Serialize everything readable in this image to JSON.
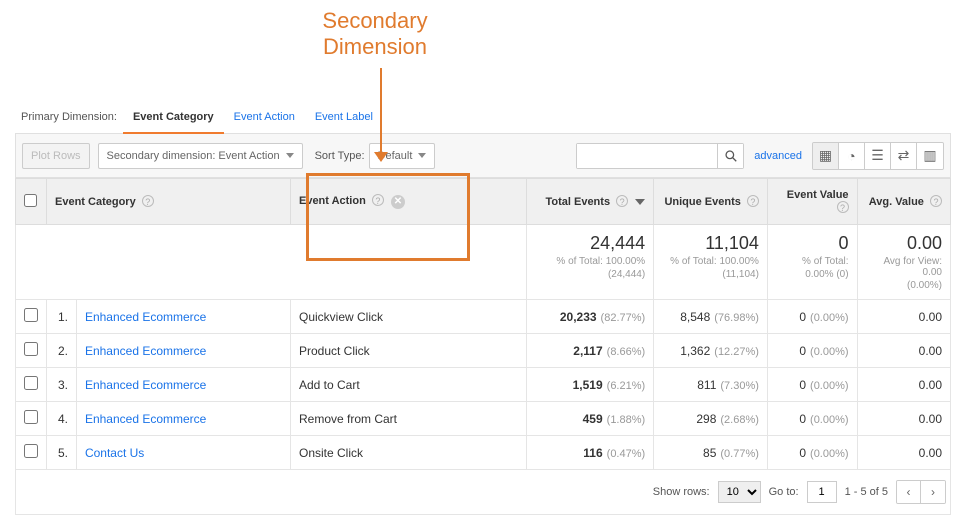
{
  "annotation": "Secondary Dimension",
  "primary": {
    "label": "Primary Dimension:",
    "options": [
      "Event Category",
      "Event Action",
      "Event Label"
    ],
    "active": "Event Category"
  },
  "toolbar": {
    "plot_rows": "Plot Rows",
    "secondary_dimension": "Secondary dimension: Event Action",
    "sort_type_label": "Sort Type:",
    "sort_type_value": "Default",
    "search_value": "",
    "advanced": "advanced"
  },
  "columns": {
    "event_category": "Event Category",
    "event_action": "Event Action",
    "total_events": "Total Events",
    "unique_events": "Unique Events",
    "event_value": "Event Value",
    "avg_value": "Avg. Value"
  },
  "totals": {
    "total_events": {
      "big": "24,444",
      "sub1": "% of Total: 100.00%",
      "sub2": "(24,444)"
    },
    "unique_events": {
      "big": "11,104",
      "sub1": "% of Total: 100.00%",
      "sub2": "(11,104)"
    },
    "event_value": {
      "big": "0",
      "sub1": "% of Total:",
      "sub2": "0.00% (0)"
    },
    "avg_value": {
      "big": "0.00",
      "sub1": "Avg for View: 0.00",
      "sub2": "(0.00%)"
    }
  },
  "rows": [
    {
      "idx": "1.",
      "category": "Enhanced Ecommerce",
      "action": "Quickview Click",
      "te": "20,233",
      "te_pct": "(82.77%)",
      "ue": "8,548",
      "ue_pct": "(76.98%)",
      "ev": "0",
      "ev_pct": "(0.00%)",
      "av": "0.00"
    },
    {
      "idx": "2.",
      "category": "Enhanced Ecommerce",
      "action": "Product Click",
      "te": "2,117",
      "te_pct": "(8.66%)",
      "ue": "1,362",
      "ue_pct": "(12.27%)",
      "ev": "0",
      "ev_pct": "(0.00%)",
      "av": "0.00"
    },
    {
      "idx": "3.",
      "category": "Enhanced Ecommerce",
      "action": "Add to Cart",
      "te": "1,519",
      "te_pct": "(6.21%)",
      "ue": "811",
      "ue_pct": "(7.30%)",
      "ev": "0",
      "ev_pct": "(0.00%)",
      "av": "0.00"
    },
    {
      "idx": "4.",
      "category": "Enhanced Ecommerce",
      "action": "Remove from Cart",
      "te": "459",
      "te_pct": "(1.88%)",
      "ue": "298",
      "ue_pct": "(2.68%)",
      "ev": "0",
      "ev_pct": "(0.00%)",
      "av": "0.00"
    },
    {
      "idx": "5.",
      "category": "Contact Us",
      "action": "Onsite Click",
      "te": "116",
      "te_pct": "(0.47%)",
      "ue": "85",
      "ue_pct": "(0.77%)",
      "ev": "0",
      "ev_pct": "(0.00%)",
      "av": "0.00"
    }
  ],
  "pagination": {
    "show_rows_label": "Show rows:",
    "show_rows_value": "10",
    "goto_label": "Go to:",
    "goto_value": "1",
    "range": "1 - 5 of 5"
  }
}
